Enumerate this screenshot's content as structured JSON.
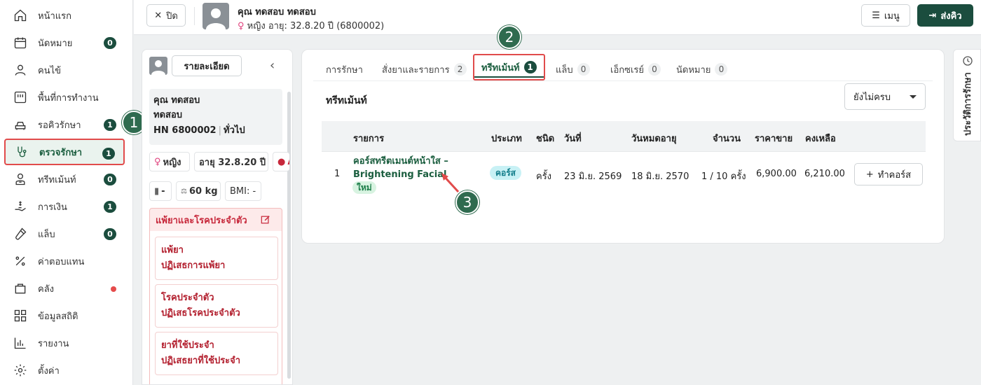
{
  "sidebar": {
    "items": [
      {
        "label": "หน้าแรก",
        "icon": "home-icon"
      },
      {
        "label": "นัดหมาย",
        "icon": "calendar-icon",
        "badge": "0"
      },
      {
        "label": "คนไข้",
        "icon": "user-icon"
      },
      {
        "label": "พื้นที่การทำงาน",
        "icon": "workspace-icon"
      },
      {
        "label": "รอคิวรักษา",
        "icon": "car-seat-icon",
        "badge": "1"
      },
      {
        "label": "ตรวจรักษา",
        "icon": "stethoscope-icon",
        "badge": "1"
      },
      {
        "label": "ทรีทเม้นท์",
        "icon": "doctor-icon",
        "badge": "0"
      },
      {
        "label": "การเงิน",
        "icon": "hand-money-icon",
        "badge": "1"
      },
      {
        "label": "แล็บ",
        "icon": "test-tube-icon",
        "badge": "0"
      },
      {
        "label": "ค่าตอบแทน",
        "icon": "percent-icon"
      },
      {
        "label": "คลัง",
        "icon": "bag-icon"
      },
      {
        "label": "ข้อมูลสถิติ",
        "icon": "grid-icon"
      },
      {
        "label": "รายงาน",
        "icon": "bar-chart-icon"
      },
      {
        "label": "ตั้งค่า",
        "icon": "gear-icon"
      }
    ],
    "step1": "1"
  },
  "topbar": {
    "close_label": "ปิด",
    "patient_name": "คุณ ทดสอบ ทดสอบ",
    "patient_sex": "หญิง",
    "patient_age": "อายุ: 32.8.20 ปี",
    "patient_hn": "(6800002)",
    "menu_label": "เมนู",
    "send_label": "ส่งคิว"
  },
  "patient_panel": {
    "detail_label": "รายละเอียด",
    "name_line1": "คุณ ทดสอบ",
    "name_line2": "ทดสอบ",
    "hn": "HN 6800002",
    "patient_type": "ทั่วไป",
    "sex": "หญิง",
    "age": "อายุ 32.8.20 ปี",
    "blood": "A",
    "height": "-",
    "weight": "60 kg",
    "bmi": "BMI: -",
    "allergy_title": "แพ้ยาและโรคประจำตัว",
    "cards": [
      {
        "title": "แพ้ยา",
        "value": "ปฏิเสธการแพ้ยา"
      },
      {
        "title": "โรคประจำตัว",
        "value": "ปฏิเสธโรคประจำตัว"
      },
      {
        "title": "ยาที่ใช้ประจำ",
        "value": "ปฏิเสธยาที่ใช้ประจำ"
      }
    ]
  },
  "main": {
    "tabs": [
      {
        "label": "การรักษา"
      },
      {
        "label": "สั่งยาและรายการ",
        "count": "2"
      },
      {
        "label": "ทรีทเม้นท์",
        "count": "1"
      },
      {
        "label": "แล็บ",
        "count": "0"
      },
      {
        "label": "เอ็กซเรย์",
        "count": "0"
      },
      {
        "label": "นัดหมาย",
        "count": "0"
      }
    ],
    "step2": "2",
    "section_title": "ทรีทเม้นท์",
    "filter_value": "ยังไม่ครบ",
    "columns": [
      "รายการ",
      "ประเภท",
      "ชนิด",
      "วันที่",
      "วันหมดอายุ",
      "จำนวน",
      "ราคาขาย",
      "คงเหลือ"
    ],
    "rows": [
      {
        "index": "1",
        "name_line1": "คอร์สทรีตเมนต์หน้าใส –",
        "name_line2": "Brightening Facial",
        "status": "ใหม่",
        "type": "คอร์ส",
        "kind": "ครั้ง",
        "date": "23 มิ.ย. 2569",
        "expire": "18 มิ.ย. 2570",
        "qty": "1 / 10 ครั้ง",
        "price": "6,900.00",
        "remaining": "6,210.00",
        "action": "ทำคอร์ส"
      }
    ],
    "step3": "3"
  },
  "history_tab": {
    "label": "ประวัติการรักษา"
  },
  "colors": {
    "primary": "#1b4d3e",
    "highlight": "#e14b4b",
    "step": "#2f6b4f"
  }
}
